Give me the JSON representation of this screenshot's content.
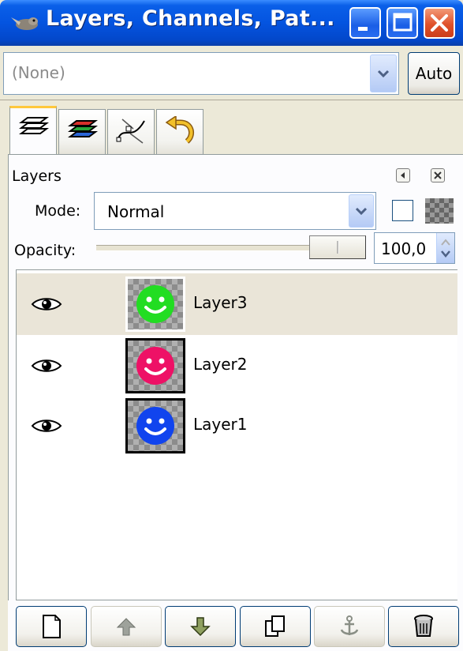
{
  "window": {
    "title": "Layers, Channels, Pat...",
    "controls": [
      "minimize",
      "maximize",
      "close"
    ]
  },
  "image_selector": {
    "value": "(None)",
    "auto_label": "Auto"
  },
  "tabs": [
    {
      "name": "layers-tab",
      "icon": "layers-icon",
      "active": true
    },
    {
      "name": "channels-tab",
      "icon": "channels-icon",
      "active": false
    },
    {
      "name": "paths-tab",
      "icon": "paths-icon",
      "active": false
    },
    {
      "name": "undo-history-tab",
      "icon": "undo-icon",
      "active": false
    }
  ],
  "layers_panel": {
    "title": "Layers",
    "mode_label": "Mode:",
    "mode_value": "Normal",
    "opacity_label": "Opacity:",
    "opacity_value": "100,0",
    "opacity_fraction": 1.0
  },
  "layers": [
    {
      "name": "Layer3",
      "visible": true,
      "selected": true,
      "color": "#22DD22"
    },
    {
      "name": "Layer2",
      "visible": true,
      "selected": false,
      "color": "#EE1166"
    },
    {
      "name": "Layer1",
      "visible": true,
      "selected": false,
      "color": "#1144EE"
    }
  ],
  "bottom_buttons": [
    {
      "name": "new-layer-button",
      "icon": "new-layer-icon"
    },
    {
      "name": "raise-layer-button",
      "icon": "arrow-up-icon",
      "disabled": true
    },
    {
      "name": "lower-layer-button",
      "icon": "arrow-down-icon"
    },
    {
      "name": "duplicate-layer-button",
      "icon": "duplicate-icon"
    },
    {
      "name": "anchor-layer-button",
      "icon": "anchor-icon",
      "disabled": true
    },
    {
      "name": "delete-layer-button",
      "icon": "trash-icon"
    }
  ]
}
